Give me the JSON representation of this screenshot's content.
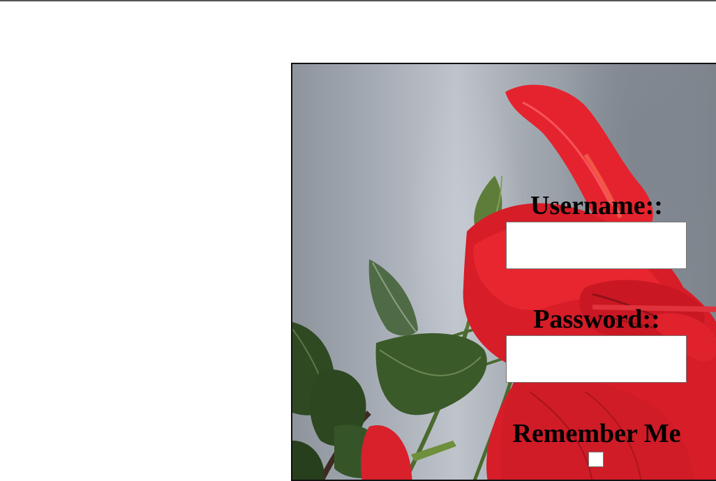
{
  "login": {
    "username_label": "Username::",
    "username_value": "",
    "password_label": "Password::",
    "password_value": "",
    "remember_label": "Remember Me",
    "remember_checked": false
  },
  "background": {
    "image_subject": "red hibiscus flower",
    "sky_color": "#a6acb5",
    "petal_color": "#e01e2a",
    "leaf_color": "#3c5a2c"
  }
}
